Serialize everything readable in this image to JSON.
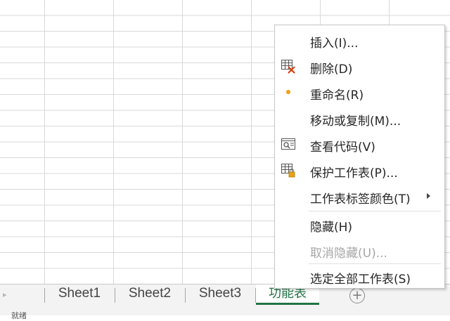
{
  "tabs": {
    "sheets": [
      "Sheet1",
      "Sheet2",
      "Sheet3"
    ],
    "active": "功能表",
    "add_symbol": "+",
    "nav_arrow": "▸"
  },
  "status": {
    "text": "就绪"
  },
  "context_menu": {
    "items": [
      {
        "label": "插入(I)...",
        "icon": "none"
      },
      {
        "label": "删除(D)",
        "icon": "delete-sheet-icon"
      },
      {
        "label": "重命名(R)",
        "icon": "bullet-icon"
      },
      {
        "label": "移动或复制(M)...",
        "icon": "none"
      },
      {
        "label": "查看代码(V)",
        "icon": "view-code-icon"
      },
      {
        "label": "保护工作表(P)...",
        "icon": "protect-sheet-icon"
      },
      {
        "label": "工作表标签颜色(T)",
        "icon": "none",
        "submenu": true
      },
      {
        "label": "隐藏(H)",
        "icon": "none"
      },
      {
        "label": "取消隐藏(U)...",
        "icon": "none",
        "disabled": true
      },
      {
        "label": "选定全部工作表(S)",
        "icon": "none"
      }
    ]
  },
  "colors": {
    "accent": "#217346",
    "bullet": "#f39c12",
    "delete_x": "#d83b01",
    "lock": "#e8a317"
  }
}
